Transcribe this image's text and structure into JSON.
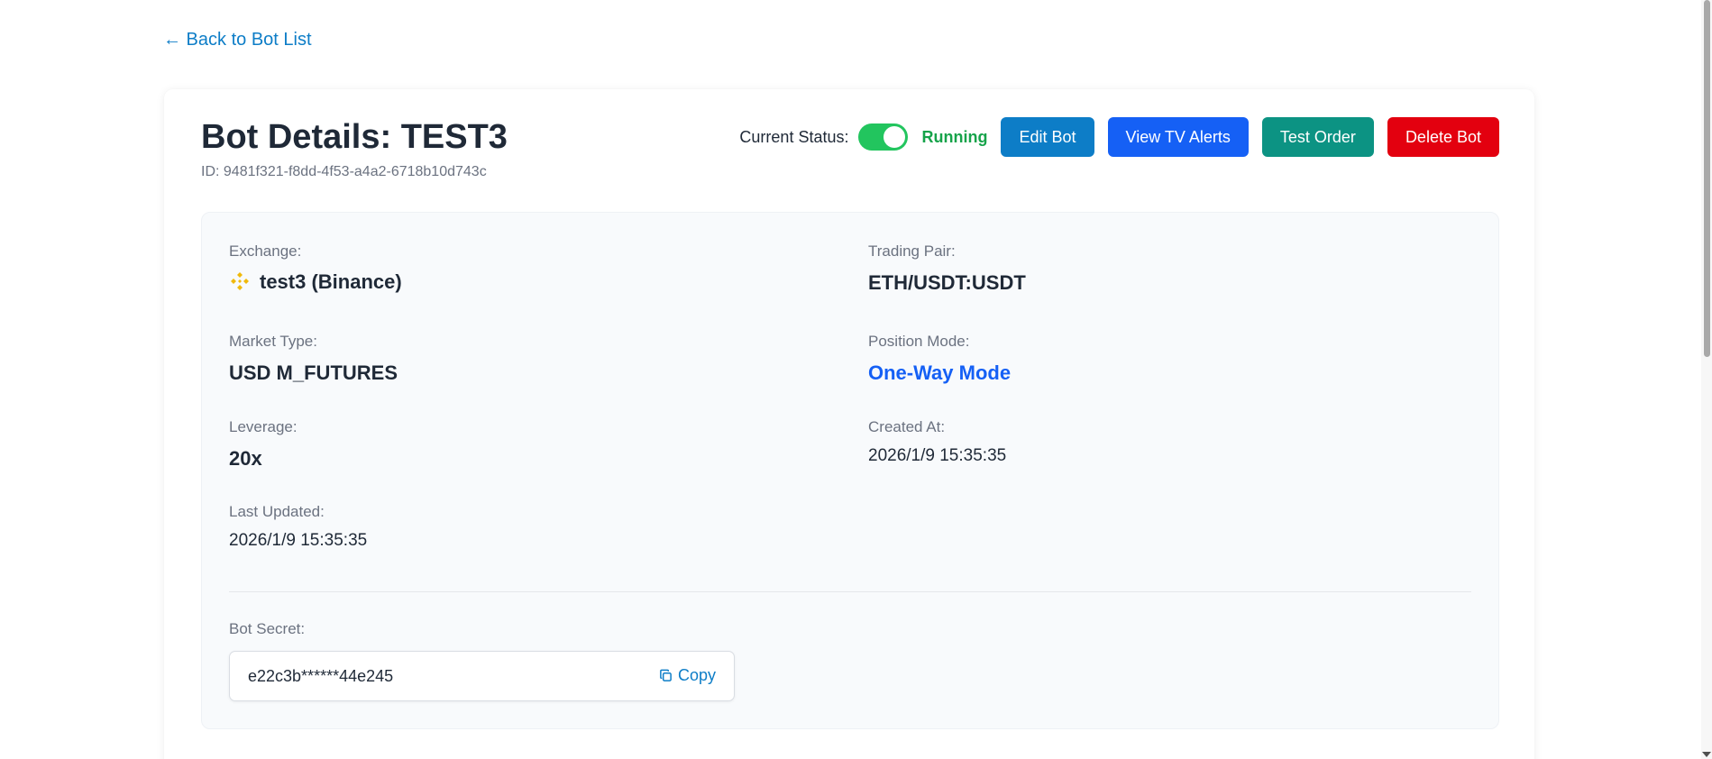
{
  "nav": {
    "back_label": "← Back to Bot List"
  },
  "header": {
    "title": "Bot Details: TEST3",
    "id_text": "ID: 9481f321-f8dd-4f53-a4a2-6718b10d743c",
    "status_label": "Current Status:",
    "status_on": true,
    "status_value": "Running",
    "buttons": {
      "edit": "Edit Bot",
      "alerts": "View TV Alerts",
      "test": "Test Order",
      "delete": "Delete Bot"
    }
  },
  "details": {
    "exchange_label": "Exchange:",
    "exchange_value": "test3 (Binance)",
    "exchange_icon": "binance-icon",
    "pair_label": "Trading Pair:",
    "pair_value": "ETH/USDT:USDT",
    "market_type_label": "Market Type:",
    "market_type_value": "USD M_FUTURES",
    "position_mode_label": "Position Mode:",
    "position_mode_value": "One-Way Mode",
    "leverage_label": "Leverage:",
    "leverage_value": "20x",
    "created_label": "Created At:",
    "created_value": "2026/1/9 15:35:35",
    "updated_label": "Last Updated:",
    "updated_value": "2026/1/9 15:35:35",
    "secret_label": "Bot Secret:",
    "secret_value": "e22c3b******44e245",
    "copy_label": "Copy",
    "copy_icon": "copy-icon"
  },
  "colors": {
    "link": "#0d7dc7",
    "running": "#16a34a",
    "toggle_on": "#22c55e",
    "edit_button": "#0d7dc7",
    "alerts_button": "#1560f5",
    "test_button": "#0c9383",
    "delete_button": "#e3000f",
    "position_mode": "#1560f5",
    "binance": "#f0b90b"
  }
}
